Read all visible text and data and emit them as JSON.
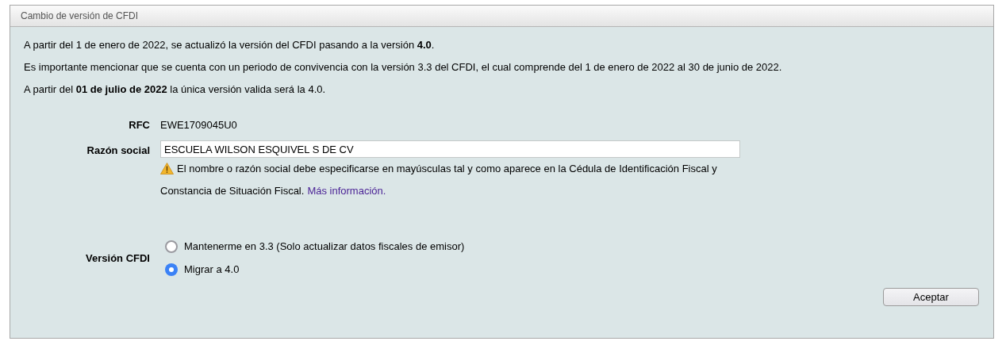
{
  "panel": {
    "title": "Cambio de versión de CFDI"
  },
  "paragraphs": [
    "A partir del 1 de enero de 2022, se actualizó la versión del CFDI pasando a la versión **4.0**.",
    "Es importante mencionar que se cuenta con un periodo de convivencia con la versión 3.3 del CFDI, el cual comprende del 1 de enero de 2022 al 30 de junio de 2022.",
    "A partir del **01 de julio de 2022** la única versión valida será la 4.0."
  ],
  "rfc": {
    "label": "RFC",
    "value": "EWE1709045U0"
  },
  "razon_social": {
    "label": "Razón social",
    "value": "ESCUELA WILSON ESQUIVEL S DE CV",
    "note_lines": [
      "El nombre o razón social debe especificarse en mayúsculas tal y como aparece en la Cédula de Identificación Fiscal y",
      "Constancia de Situación Fiscal."
    ],
    "link": "Más información."
  },
  "version": {
    "label": "Versión CFDI",
    "options": [
      {
        "label": "Mantenerme en 3.3 (Solo actualizar datos fiscales de emisor)",
        "selected": false
      },
      {
        "label": "Migrar a 4.0",
        "selected": true
      }
    ]
  },
  "buttons": [
    "Aceptar"
  ]
}
